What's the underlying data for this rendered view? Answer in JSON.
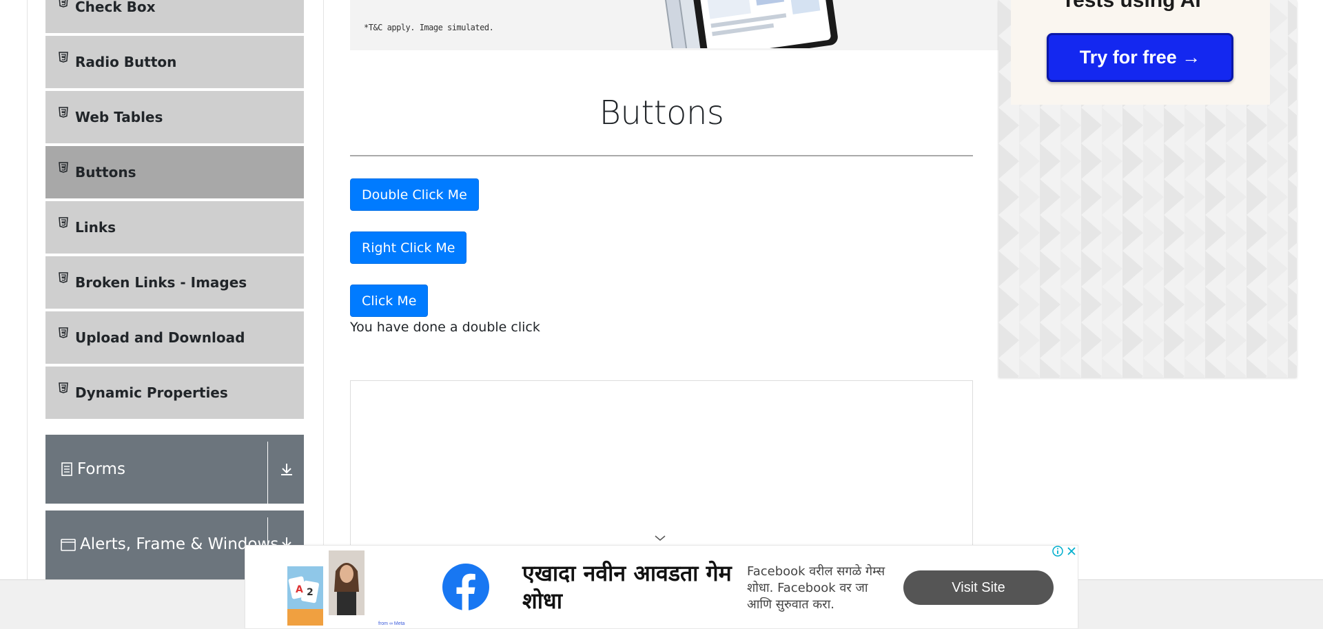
{
  "sidebar": {
    "items": [
      {
        "label": "Check Box",
        "icon": "html5-icon"
      },
      {
        "label": "Radio Button",
        "icon": "html5-icon"
      },
      {
        "label": "Web Tables",
        "icon": "html5-icon"
      },
      {
        "label": "Buttons",
        "icon": "html5-icon",
        "active": true
      },
      {
        "label": "Links",
        "icon": "html5-icon"
      },
      {
        "label": "Broken Links - Images",
        "icon": "html5-icon"
      },
      {
        "label": "Upload and Download",
        "icon": "html5-icon"
      },
      {
        "label": "Dynamic Properties",
        "icon": "html5-icon"
      }
    ],
    "groups": [
      {
        "label": "Forms",
        "icon": "document-icon",
        "toggle_icon": "download-arrow-icon"
      },
      {
        "label": "Alerts, Frame & Windows",
        "icon": "window-icon",
        "toggle_icon": "download-arrow-icon"
      }
    ]
  },
  "banner": {
    "disclaimer": "*T&C apply. Image simulated."
  },
  "main": {
    "title": "Buttons",
    "buttons": {
      "double_click": "Double Click Me",
      "right_click": "Right Click Me",
      "click": "Click Me"
    },
    "result_message": "You have done a double click"
  },
  "right_ad": {
    "heading": "Tests using AI",
    "cta": "Try for free →"
  },
  "bottom_ad": {
    "headline": "एखादा नवीन आवडता गेम शोधा",
    "description": "Facebook वरील सगळे गेम्स शोधा. Facebook वर जा आणि सुरुवात करा.",
    "cta": "Visit Site",
    "meta_tag": "from ∞ Meta"
  },
  "colors": {
    "primary_button": "#007bff",
    "sidebar_item": "#cfcfcf",
    "sidebar_active": "#a8a8a8",
    "group_header": "#6c757d",
    "ad_cta": "#1428f0",
    "facebook_blue": "#1877f2"
  }
}
